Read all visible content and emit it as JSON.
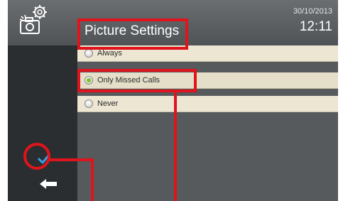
{
  "header": {
    "icon": "camera-settings-icon",
    "title": "Picture Settings",
    "date": "30/10/2013",
    "time": "12:11"
  },
  "options": [
    {
      "label": "Always",
      "selected": false
    },
    {
      "label": "Only Missed Calls",
      "selected": true
    },
    {
      "label": "Never",
      "selected": false
    }
  ],
  "sidebar": {
    "confirm_icon": "check-icon",
    "back_icon": "back-arrow-icon"
  },
  "colors": {
    "annotation": "#e0141c",
    "radio_selected": "#7cc41d",
    "check": "#3aa0e8"
  }
}
